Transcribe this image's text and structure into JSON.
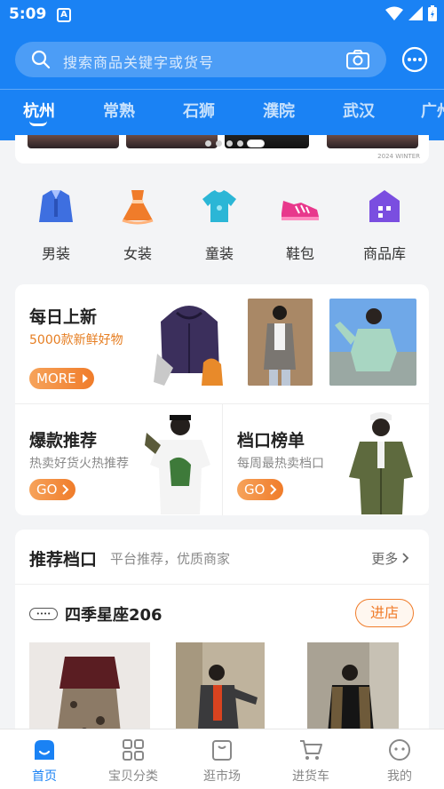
{
  "status_bar": {
    "time": "5:09",
    "app_badge": "A"
  },
  "search": {
    "placeholder": "搜索商品关键字或货号"
  },
  "city_tabs": [
    "杭州",
    "常熟",
    "石狮",
    "濮院",
    "武汉",
    "广州"
  ],
  "banner": {
    "watermark": "2024 WINTER"
  },
  "categories": [
    {
      "label": "男装",
      "icon": "men-suit-icon",
      "color": "#3e6fe0"
    },
    {
      "label": "女装",
      "icon": "women-dress-icon",
      "color": "#f07c2a"
    },
    {
      "label": "童装",
      "icon": "kids-shirt-icon",
      "color": "#2bb6d6"
    },
    {
      "label": "鞋包",
      "icon": "shoe-icon",
      "color": "#e8388c"
    },
    {
      "label": "商品库",
      "icon": "warehouse-icon",
      "color": "#7a4ee0"
    }
  ],
  "daily": {
    "title": "每日上新",
    "subtitle": "5000款新鲜好物",
    "button": "MORE"
  },
  "hot": {
    "title": "爆款推荐",
    "subtitle": "热卖好货火热推荐",
    "button": "GO"
  },
  "rank": {
    "title": "档口榜单",
    "subtitle": "每周最热卖档口",
    "button": "GO"
  },
  "shops": {
    "title": "推荐档口",
    "subtitle": "平台推荐，优质商家",
    "more": "更多",
    "shop_name": "四季星座206",
    "enter": "进店"
  },
  "bottom_nav": [
    "首页",
    "宝贝分类",
    "逛市场",
    "进货车",
    "我的"
  ],
  "colors": {
    "primary": "#1a82f4",
    "accent": "#f07c2a"
  }
}
